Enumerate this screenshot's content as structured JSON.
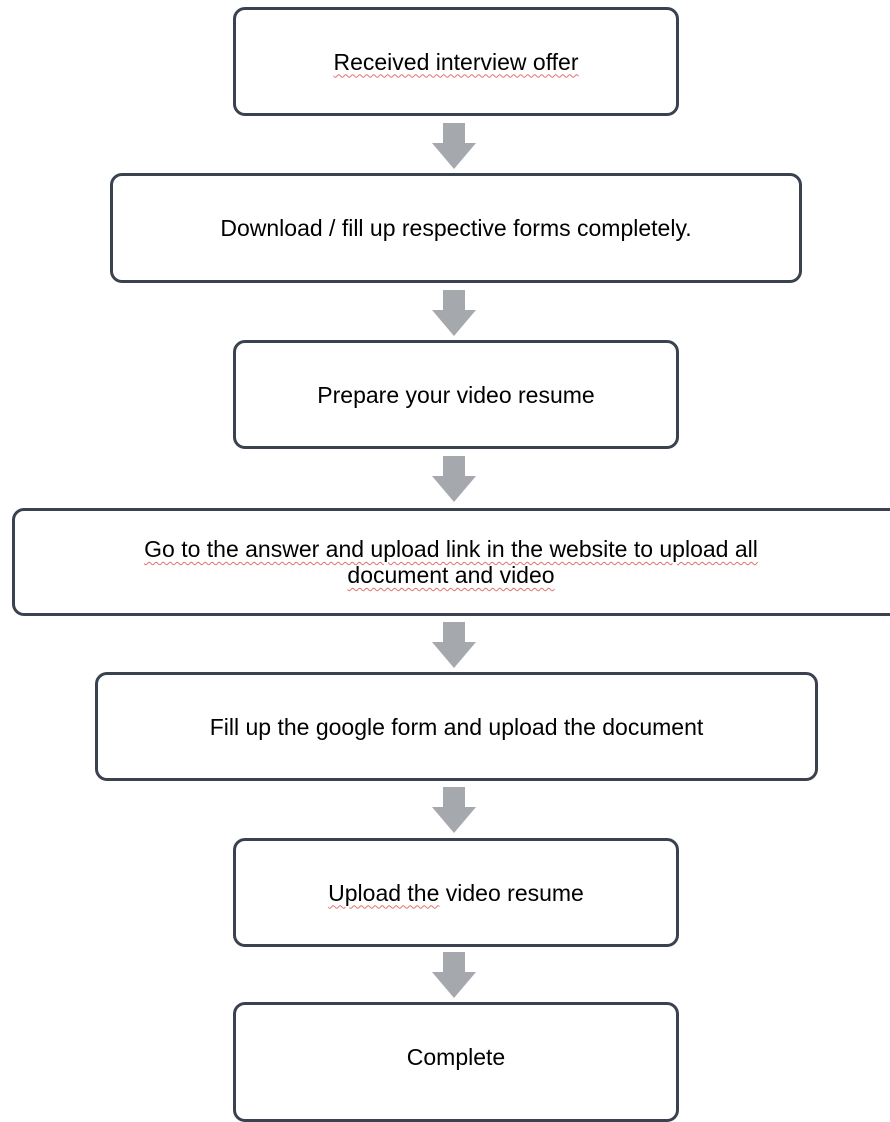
{
  "colors": {
    "box_border": "#3a4250",
    "arrow_fill": "#a5a8ad",
    "spellcheck_underline": "#e07070"
  },
  "icons": {
    "connector": "down-arrow-icon"
  },
  "steps": [
    {
      "label": "Received interview offer"
    },
    {
      "label": "Download / fill up respective forms completely."
    },
    {
      "label": "Prepare your video resume"
    },
    {
      "label_line1": "Go to the answer and upload link in the website to upload all",
      "label_line2": "document and video"
    },
    {
      "label": "Fill up the google form and upload the document"
    },
    {
      "label_part1": "Upload the",
      "label_part2": " video resume"
    },
    {
      "label": "Complete"
    }
  ]
}
